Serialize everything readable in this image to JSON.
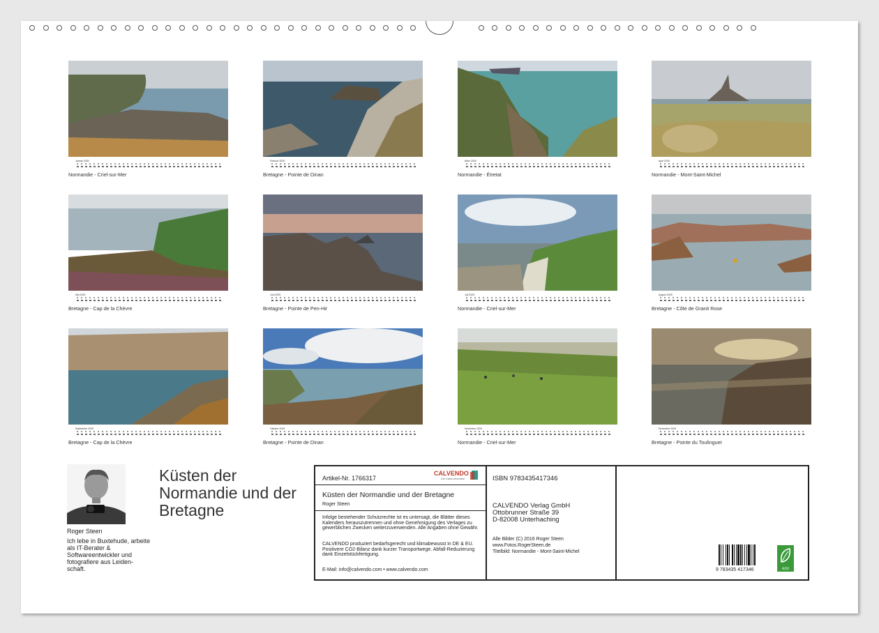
{
  "months": [
    {
      "name": "Januar 2025",
      "caption": "Normandie - Criel-sur-Mer",
      "scene": "cliff"
    },
    {
      "name": "Februar 2025",
      "caption": "Bretagne - Pointe de Dinan",
      "scene": "rocks"
    },
    {
      "name": "März 2025",
      "caption": "Normandie - Étretat",
      "scene": "green-cliff"
    },
    {
      "name": "April 2025",
      "caption": "Normandie - Mont-Saint-Michel",
      "scene": "mont"
    },
    {
      "name": "Mai 2025",
      "caption": "Bretagne - Cap de la Chèvre",
      "scene": "green-coast"
    },
    {
      "name": "Juni 2025",
      "caption": "Bretagne - Pointe de Pen-Hir",
      "scene": "sunset-rocks"
    },
    {
      "name": "Juli 2025",
      "caption": "Normandie - Criel-sur-Mer",
      "scene": "white-cliff"
    },
    {
      "name": "August 2025",
      "caption": "Bretagne - Côte de Granit Rose",
      "scene": "granite"
    },
    {
      "name": "September 2025",
      "caption": "Bretagne - Cap de la Chèvre",
      "scene": "cliff-bay"
    },
    {
      "name": "Oktober 2025",
      "caption": "Bretagne - Pointe de Dinan",
      "scene": "cloud-coast"
    },
    {
      "name": "November 2025",
      "caption": "Normandie - Criel-sur-Mer",
      "scene": "meadow"
    },
    {
      "name": "Dezember 2025",
      "caption": "Bretagne - Pointe du Toulinguet",
      "scene": "dusk"
    }
  ],
  "author": {
    "name": "Roger Steen",
    "bio": "Ich lebe in Buxtehude, arbeite als IT-Berater & Softwareentwickler und fotografiere aus Leiden-schaft."
  },
  "title": "Küsten der Normandie und der Bretagne",
  "info": {
    "article": "Artikel-Nr. 1766317",
    "brand": "CALVENDO",
    "brand_sub": "Die Kalendermarke",
    "book_title": "Küsten der Normandie und der Bretagne",
    "book_author": "Roger Steen",
    "notice": "Infolge bestehender Schutzrechte ist es untersagt, die Blätter dieses Kalenders herauszutrennen und ohne Genehmigung des Verlages zu gewerblichen Zwecken weiterzuverwenden. Alle Angaben ohne Gewähr.",
    "eco_text": "CALVENDO produziert bedarfsgerecht und klimabewusst in DE & EU. Positivere CO2-Bilanz dank kurzer Transportwege. Abfall-Reduzierung dank Einzelstückfertigung.",
    "contact": "E-Mail: info@calvendo.com • www.calvendo.com",
    "isbn": "ISBN 9783435417346",
    "publisher_name": "CALVENDO Verlag GmbH",
    "publisher_street": "Ottobrunner Straße 39",
    "publisher_city": "D-82008 Unterhaching",
    "credits_1": "Alle Bilder (C) 2016 Roger Steen",
    "credits_2": "www.Fotos.RogerSteen.de",
    "credits_3": "Titelbild: Normandie - Mont-Saint-Michel",
    "barcode_number": "9 783435 417346",
    "eco_badge": "eco"
  },
  "colors": {
    "brand": "#c0392b",
    "eco": "#3a9a3a"
  }
}
